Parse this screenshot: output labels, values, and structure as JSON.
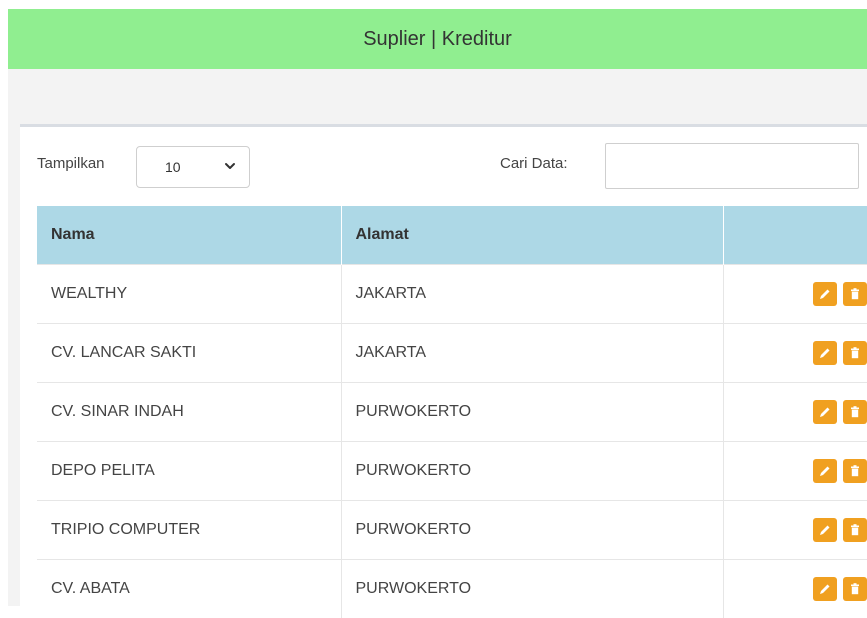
{
  "header": {
    "title": "Suplier | Kreditur"
  },
  "toolbar": {
    "show_label": "Tampilkan",
    "page_size": "10",
    "search_label": "Cari Data:",
    "search_value": ""
  },
  "table": {
    "columns": [
      "Nama",
      "Alamat",
      ""
    ],
    "rows": [
      {
        "nama": "WEALTHY",
        "alamat": "JAKARTA"
      },
      {
        "nama": "CV. LANCAR SAKTI",
        "alamat": "JAKARTA"
      },
      {
        "nama": "CV. SINAR INDAH",
        "alamat": "PURWOKERTO"
      },
      {
        "nama": "DEPO PELITA",
        "alamat": "PURWOKERTO"
      },
      {
        "nama": "TRIPIO COMPUTER",
        "alamat": "PURWOKERTO"
      },
      {
        "nama": "CV. ABATA",
        "alamat": "PURWOKERTO"
      }
    ]
  },
  "icons": {
    "edit": "pencil-icon",
    "delete": "trash-icon",
    "dropdown": "chevron-down-icon"
  },
  "colors": {
    "header_bg": "#90ee90",
    "table_header_bg": "#add8e6",
    "action_button": "#f0a020"
  }
}
